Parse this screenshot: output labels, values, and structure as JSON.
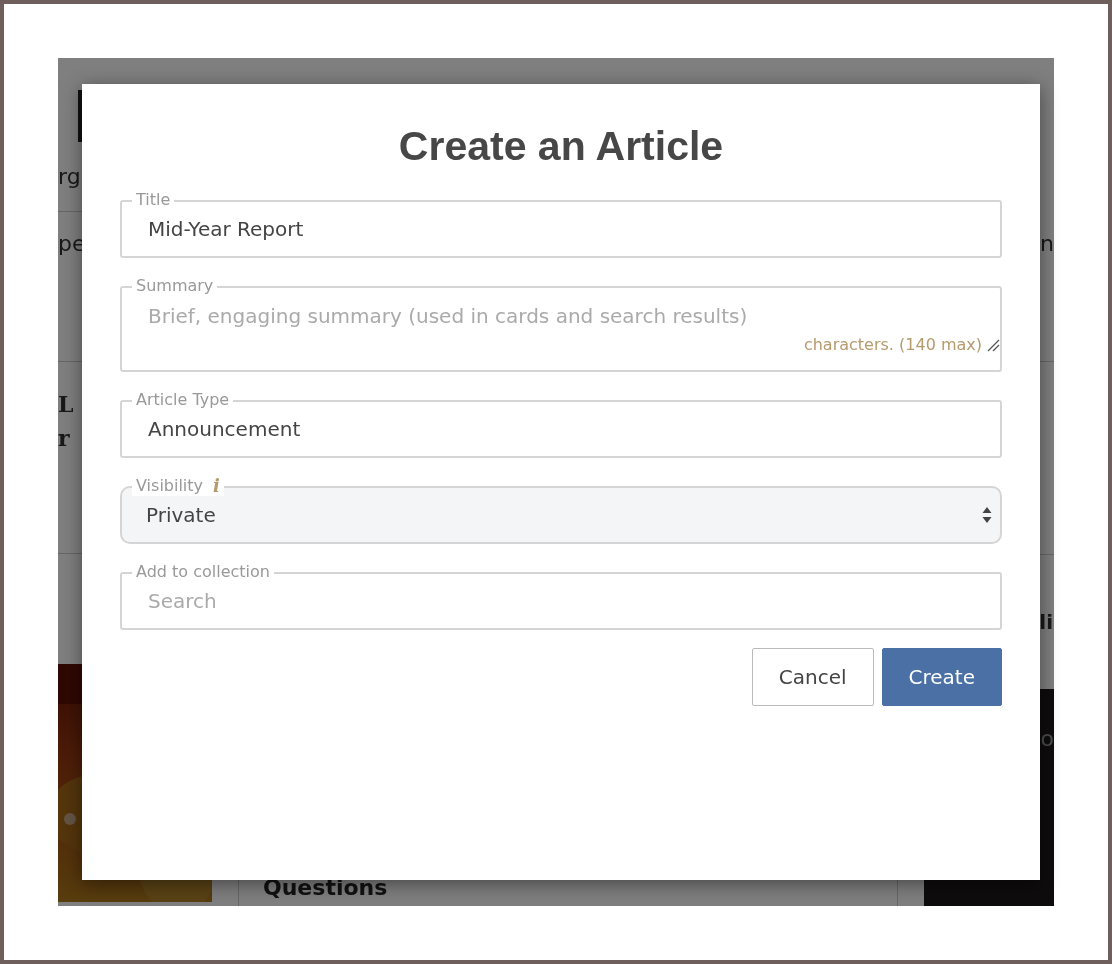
{
  "background": {
    "left_texts": [
      "rg",
      "pe",
      "L",
      "r"
    ],
    "card_title": "Questions",
    "right_texts": [
      "n",
      "li",
      "o"
    ]
  },
  "dialog": {
    "title": "Create an Article",
    "fields": [
      {
        "kind": "input",
        "label": "Title",
        "value": "Mid-Year Report"
      },
      {
        "kind": "textarea",
        "label": "Summary",
        "placeholder": "Brief, engaging summary (used in cards and search results)",
        "counter": "characters. (140 max)"
      },
      {
        "kind": "input",
        "label": "Article Type",
        "value": "Announcement"
      },
      {
        "kind": "select",
        "label": "Visibility",
        "info": "i",
        "value": "Private"
      },
      {
        "kind": "input",
        "label": "Add to collection",
        "placeholder": "Search"
      }
    ],
    "buttons": [
      {
        "kind": "secondary",
        "label": "Cancel"
      },
      {
        "kind": "primary",
        "label": "Create"
      }
    ]
  }
}
